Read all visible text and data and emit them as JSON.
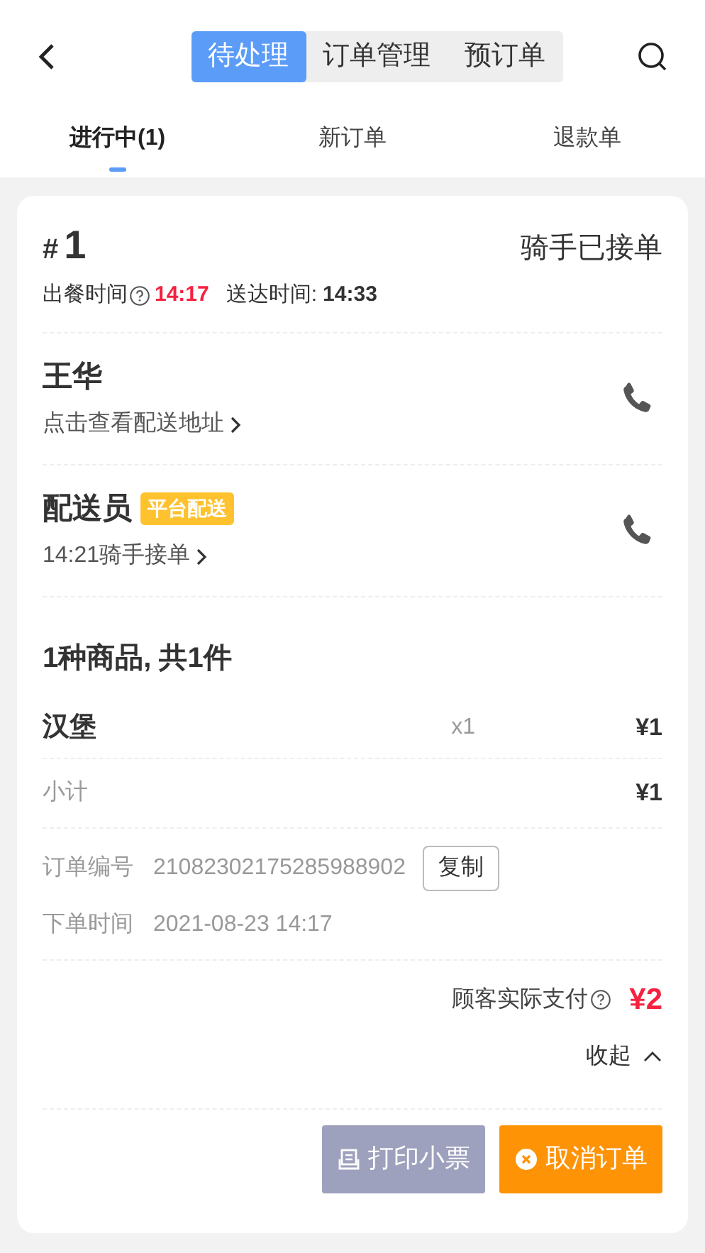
{
  "top_tabs": [
    {
      "label": "待处理",
      "selected": true
    },
    {
      "label": "订单管理",
      "selected": false
    },
    {
      "label": "预订单",
      "selected": false
    }
  ],
  "sub_tabs": [
    {
      "label": "进行中(1)",
      "selected": true
    },
    {
      "label": "新订单",
      "selected": false
    },
    {
      "label": "退款单",
      "selected": false
    }
  ],
  "order": {
    "hash": "#",
    "number": "1",
    "status": "骑手已接单",
    "meal_time_label": "出餐时间",
    "meal_time": "14:17",
    "delivery_label": "送达时间:",
    "delivery_time": "14:33",
    "customer": {
      "name": "王华",
      "link": "点击查看配送地址"
    },
    "rider": {
      "name": "配送员",
      "tag": "平台配送",
      "link": "14:21骑手接单"
    },
    "goods_title": "1种商品, 共1件",
    "items": [
      {
        "name": "汉堡",
        "qty": "x1",
        "price": "¥1"
      }
    ],
    "subtotal_label": "小计",
    "subtotal": "¥1",
    "order_no_label": "订单编号",
    "order_no": "21082302175285988902",
    "copy_button": "复制",
    "time_label": "下单时间",
    "order_time": "2021-08-23 14:17",
    "paid_label": "顾客实际支付",
    "paid": "¥2",
    "collapse": "收起",
    "buttons": [
      {
        "kind": "print",
        "label": "打印小票",
        "disabled": true
      },
      {
        "kind": "cancel",
        "label": "取消订单",
        "disabled": false
      }
    ]
  }
}
